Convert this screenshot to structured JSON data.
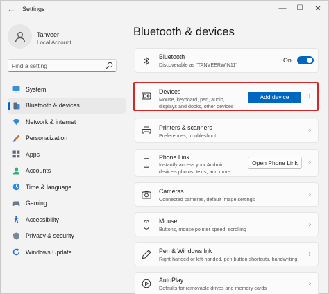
{
  "window": {
    "title": "Settings",
    "back_icon": "back-arrow-icon",
    "minimize_icon": "minimize-icon",
    "maximize_icon": "maximize-icon",
    "close_icon": "close-icon"
  },
  "profile": {
    "name": "Tanveer",
    "account_type": "Local Account"
  },
  "search": {
    "placeholder": "Find a setting",
    "value": ""
  },
  "sidebar": {
    "items": [
      {
        "label": "System",
        "icon": "monitor-icon",
        "active": false
      },
      {
        "label": "Bluetooth & devices",
        "icon": "bluetooth-icon",
        "active": true
      },
      {
        "label": "Network & internet",
        "icon": "wifi-icon",
        "active": false
      },
      {
        "label": "Personalization",
        "icon": "brush-icon",
        "active": false
      },
      {
        "label": "Apps",
        "icon": "apps-icon",
        "active": false
      },
      {
        "label": "Accounts",
        "icon": "person-icon",
        "active": false
      },
      {
        "label": "Time & language",
        "icon": "globe-clock-icon",
        "active": false
      },
      {
        "label": "Gaming",
        "icon": "gamepad-icon",
        "active": false
      },
      {
        "label": "Accessibility",
        "icon": "accessibility-icon",
        "active": false
      },
      {
        "label": "Privacy & security",
        "icon": "shield-icon",
        "active": false
      },
      {
        "label": "Windows Update",
        "icon": "update-icon",
        "active": false
      }
    ]
  },
  "main": {
    "title": "Bluetooth & devices",
    "bluetooth": {
      "title": "Bluetooth",
      "desc": "Discoverable as \"TANVEERWIN11\"",
      "toggle_label": "On",
      "toggle_on": true
    },
    "devices": {
      "title": "Devices",
      "desc": "Mouse, keyboard, pen, audio, displays and docks, other devices",
      "button": "Add device"
    },
    "printers": {
      "title": "Printers & scanners",
      "desc": "Preferences, troubleshoot"
    },
    "phone_link": {
      "title": "Phone Link",
      "desc": "Instantly access your Android device's photos, texts, and more",
      "button": "Open Phone Link"
    },
    "cameras": {
      "title": "Cameras",
      "desc": "Connected cameras, default image settings"
    },
    "mouse": {
      "title": "Mouse",
      "desc": "Buttons, mouse pointer speed, scrolling"
    },
    "pen": {
      "title": "Pen & Windows Ink",
      "desc": "Right-handed or left-handed, pen button shortcuts, handwriting"
    },
    "autoplay": {
      "title": "AutoPlay",
      "desc": "Defaults for removable drives and memory cards"
    }
  },
  "colors": {
    "accent": "#0067c0",
    "highlight_border": "#d42828"
  }
}
